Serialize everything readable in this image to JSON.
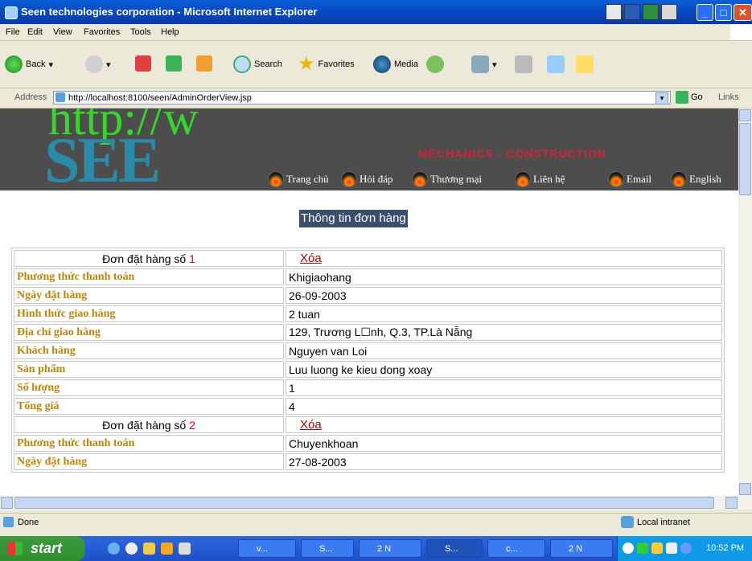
{
  "window": {
    "title": "Seen technologies corporation - Microsoft Internet Explorer",
    "min_label": "_",
    "max_label": "□",
    "close_label": "✕"
  },
  "menubar": [
    "File",
    "Edit",
    "View",
    "Favorites",
    "Tools",
    "Help"
  ],
  "toolbar": {
    "back_label": "Back",
    "search_label": "Search",
    "favorites_label": "Favorites",
    "media_label": "Media"
  },
  "address": {
    "label": "Address",
    "url": "http://localhost:8100/seen/AdminOrderView.jsp",
    "go_label": "Go",
    "links_label": "Links"
  },
  "banner": {
    "url_text": "http://w",
    "logo_text": "SEE",
    "tagline": "MECHANICS - CONSTRUCTION",
    "nav": [
      "Trang chủ",
      "Hỏi đáp",
      "Thương mại",
      "Liên hệ",
      "Email",
      "English"
    ]
  },
  "page": {
    "heading": "Thông tin đơn hàng",
    "order_prefix": "Đơn đặt hàng số",
    "delete_label": "Xóa",
    "orders": [
      {
        "number": "1",
        "rows": [
          {
            "label": "Phương thức thanh toán",
            "value": "Khigiaohang"
          },
          {
            "label": "Ngày đặt hàng",
            "value": "26-09-2003"
          },
          {
            "label": "Hình thức giao hàng",
            "value": "2 tuan"
          },
          {
            "label": "Địa chỉ giao hàng",
            "value": "129, Trương L☐nh, Q.3, TP.Là Nẵng"
          },
          {
            "label": "Khách hàng",
            "value": "Nguyen van Loi"
          },
          {
            "label": "Sản phẩm",
            "value": "Luu luong ke kieu dong xoay"
          },
          {
            "label": "Số lượng",
            "value": "1"
          },
          {
            "label": "Tổng giá",
            "value": "4"
          }
        ]
      },
      {
        "number": "2",
        "rows": [
          {
            "label": "Phương thức thanh toán",
            "value": "Chuyenkhoan"
          },
          {
            "label": "Ngày đặt hàng",
            "value": "27-08-2003"
          }
        ]
      }
    ]
  },
  "status": {
    "left": "Done",
    "zone": "Local intranet"
  },
  "taskbar": {
    "start_label": "start",
    "tasks": [
      "v...",
      "S...",
      "2 N",
      "S...",
      "c...",
      "2 N"
    ],
    "clock": "10:52 PM"
  }
}
